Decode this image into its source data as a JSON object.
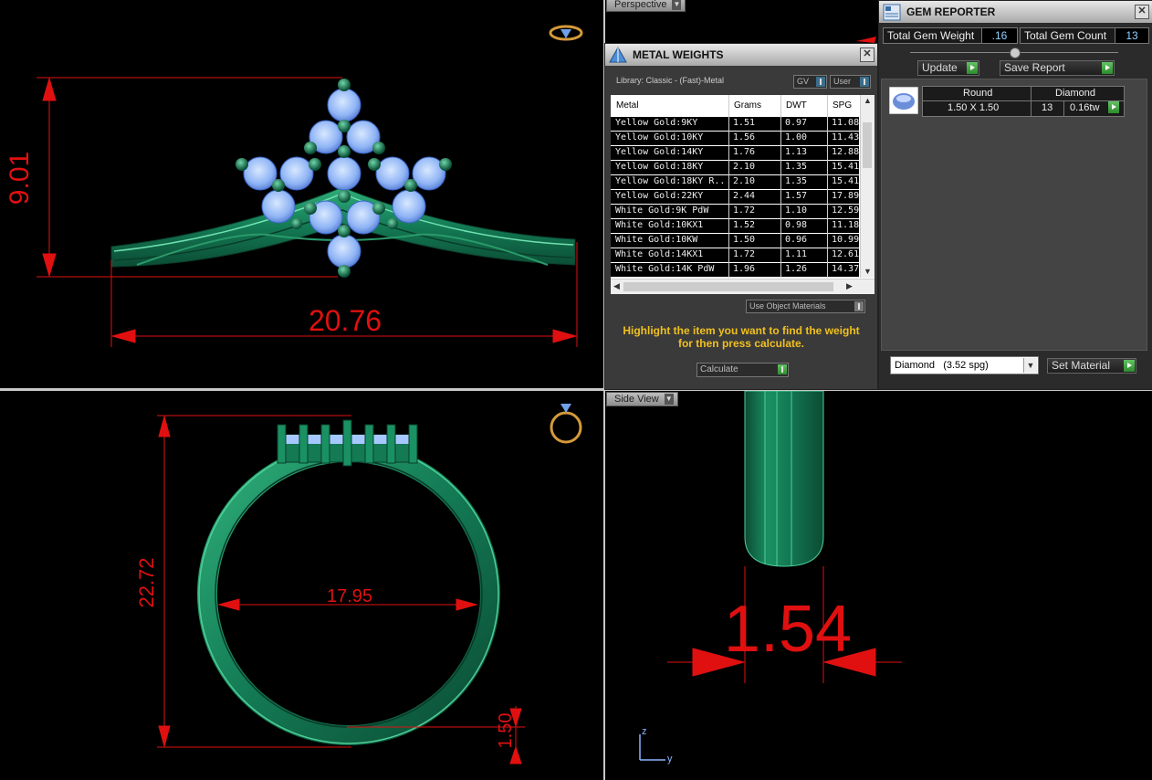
{
  "colors": {
    "metal": "#137a54",
    "gem": "#a6c8ff",
    "dimension": "#e01010",
    "msg": "#f0c020"
  },
  "viewports": {
    "top_left": {
      "dims": {
        "height": "9.01",
        "width": "20.76"
      }
    },
    "bottom_left": {
      "dims": {
        "outer": "22.72",
        "inner": "17.95",
        "band": "1.50"
      }
    },
    "bottom_right": {
      "label": "Side View",
      "dims": {
        "thickness": "1.54"
      },
      "axes": {
        "z": "z",
        "y": "y"
      }
    },
    "top_right": {
      "label": "Perspective"
    }
  },
  "metal_weights": {
    "title": "METAL WEIGHTS",
    "library": "Library: Classic - (Fast)-Metal",
    "toggle_gv": "GV",
    "toggle_user": "User",
    "columns": [
      "Metal",
      "Grams",
      "DWT",
      "SPG"
    ],
    "rows": [
      [
        "Yellow Gold:9KY",
        "1.51",
        "0.97",
        "11.08"
      ],
      [
        "Yellow Gold:10KY",
        "1.56",
        "1.00",
        "11.43"
      ],
      [
        "Yellow Gold:14KY",
        "1.76",
        "1.13",
        "12.88"
      ],
      [
        "Yellow Gold:18KY",
        "2.10",
        "1.35",
        "15.41"
      ],
      [
        "Yellow Gold:18KY R...",
        "2.10",
        "1.35",
        "15.41"
      ],
      [
        "Yellow Gold:22KY",
        "2.44",
        "1.57",
        "17.89"
      ],
      [
        "White Gold:9K PdW",
        "1.72",
        "1.10",
        "12.59"
      ],
      [
        "White Gold:10KX1",
        "1.52",
        "0.98",
        "11.18"
      ],
      [
        "White Gold:10KW",
        "1.50",
        "0.96",
        "10.99"
      ],
      [
        "White Gold:14KX1",
        "1.72",
        "1.11",
        "12.61"
      ],
      [
        "White Gold:14K PdW",
        "1.96",
        "1.26",
        "14.37"
      ]
    ],
    "use_object_materials": "Use Object Materials",
    "message": "Highlight the item you want to find the weight for then press calculate.",
    "calculate": "Calculate"
  },
  "gem_reporter": {
    "title": "GEM REPORTER",
    "total_weight_label": "Total Gem Weight",
    "total_weight_value": ".16",
    "total_count_label": "Total Gem Count",
    "total_count_value": "13",
    "update": "Update",
    "save_report": "Save Report",
    "headers": [
      "Round",
      "Diamond"
    ],
    "size": "1.50 X 1.50",
    "count": "13",
    "tw": "0.16tw",
    "material": "Diamond",
    "material_spg": "(3.52 spg)",
    "set_material": "Set Material"
  }
}
